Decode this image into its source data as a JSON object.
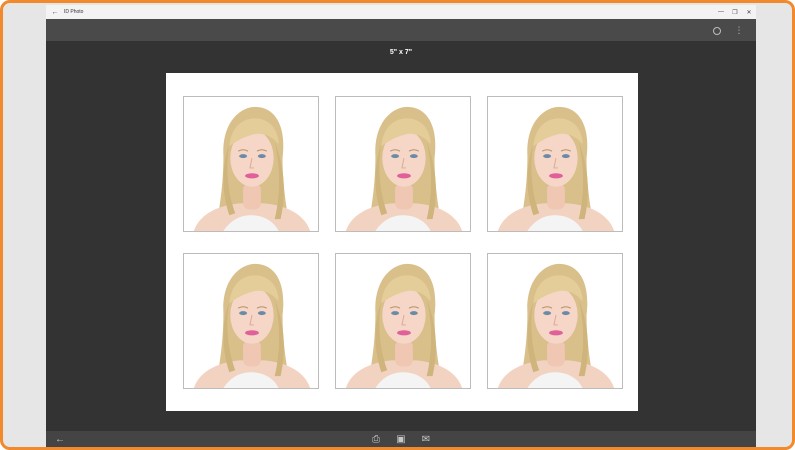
{
  "window": {
    "title": "ID Photo",
    "back_glyph": "←",
    "minimize_glyph": "—",
    "maximize_glyph": "❐",
    "close_glyph": "✕"
  },
  "toolbar": {
    "more_glyph": "⋮"
  },
  "paper": {
    "size_label": "5\" x 7\"",
    "photo_count": 6
  },
  "bottombar": {
    "back_glyph": "←",
    "print_glyph": "⎙",
    "save_glyph": "▣",
    "mail_glyph": "✉"
  },
  "icons": {
    "titlebar_back": "back-arrow-icon",
    "settings": "settings-icon",
    "more": "more-options-icon",
    "bottom_back": "back-arrow-icon",
    "print": "print-icon",
    "save": "save-icon",
    "mail": "mail-icon"
  },
  "colors": {
    "accent_border": "#f08a2c",
    "app_background": "#333333",
    "paper": "#ffffff"
  }
}
